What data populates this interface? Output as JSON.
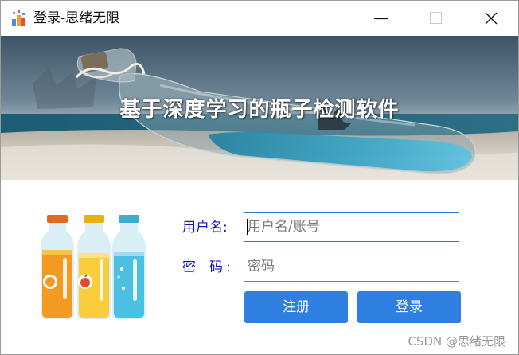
{
  "window": {
    "title": "登录-思绪无限",
    "app_icon": "app-logo-icon",
    "controls": {
      "minimize": "minimize-icon",
      "maximize": "maximize-icon",
      "close": "close-icon"
    }
  },
  "banner": {
    "title": "基于深度学习的瓶子检测软件",
    "image": "bottle-on-beach-photo"
  },
  "illustration": "three-bottles-icon",
  "form": {
    "username_label": "用户名:",
    "username_placeholder": "用户名/账号",
    "password_label_1": "密",
    "password_label_2": "码",
    "password_label_3": ":",
    "password_placeholder": "密码",
    "register_label": "注册",
    "login_label": "登录"
  },
  "watermark": "CSDN @思绪无限",
  "colors": {
    "label": "#1414c8",
    "button": "#2f7fe0",
    "focus_border": "#1f7ac8"
  }
}
